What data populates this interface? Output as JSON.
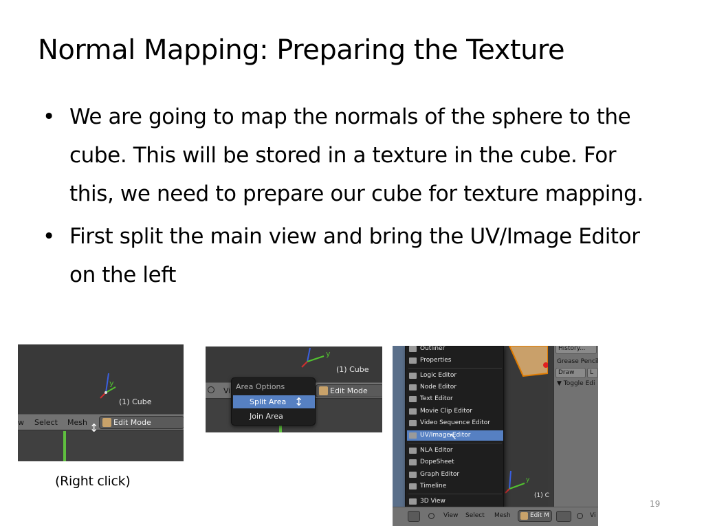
{
  "slide": {
    "title": "Normal Mapping: Preparing the Texture",
    "bullets": [
      "We are going to map the normals of the sphere to the cube. This will be stored in a texture in the cube. For this, we need to prepare our cube for texture mapping.",
      "First split the main view and bring the UV/Image Editor on the left"
    ],
    "bullet_glyph": "•",
    "caption": "(Right click)",
    "page_number": "19"
  },
  "shot1": {
    "object_label": "(1) Cube",
    "axis_label": "y",
    "menus": [
      "w",
      "Select",
      "Mesh"
    ],
    "mode_label": "Edit Mode",
    "cursor_glyph": "↕"
  },
  "shot2": {
    "object_label": "(1) Cube",
    "axis_label": "y",
    "menus": [
      "Vi"
    ],
    "mode_label": "Edit Mode",
    "popup": {
      "title": "Area Options",
      "items": [
        "Split Area",
        "Join Area"
      ],
      "selected": "Split Area"
    },
    "cursor_glyph": "↕"
  },
  "shot3": {
    "editor_menu": [
      "Outliner",
      "Properties",
      "Logic Editor",
      "Node Editor",
      "Text Editor",
      "Movie Clip Editor",
      "Video Sequence Editor",
      "UV/Image Editor",
      "NLA Editor",
      "DopeSheet",
      "Graph Editor",
      "Timeline",
      "3D View"
    ],
    "selected_item": "UV/Image Editor",
    "side_panel": {
      "history_button": "History...",
      "grease_label": "Grease Pencil",
      "draw_button": "Draw",
      "l_button": "L",
      "toggle_label": "▼ Toggle Edi"
    },
    "object_label": "(1) C",
    "axis_label": "y",
    "menus": [
      "View",
      "Select",
      "Mesh"
    ],
    "mode_label": "Edit M",
    "right_menu": "Vi",
    "cursor_glyph": "↖"
  },
  "colors": {
    "highlight": "#5680c2",
    "blender_header": "#727272",
    "viewport_bg": "#393939",
    "menu_bg": "#1e1e1e",
    "timeline_green": "#5fbf3f"
  }
}
